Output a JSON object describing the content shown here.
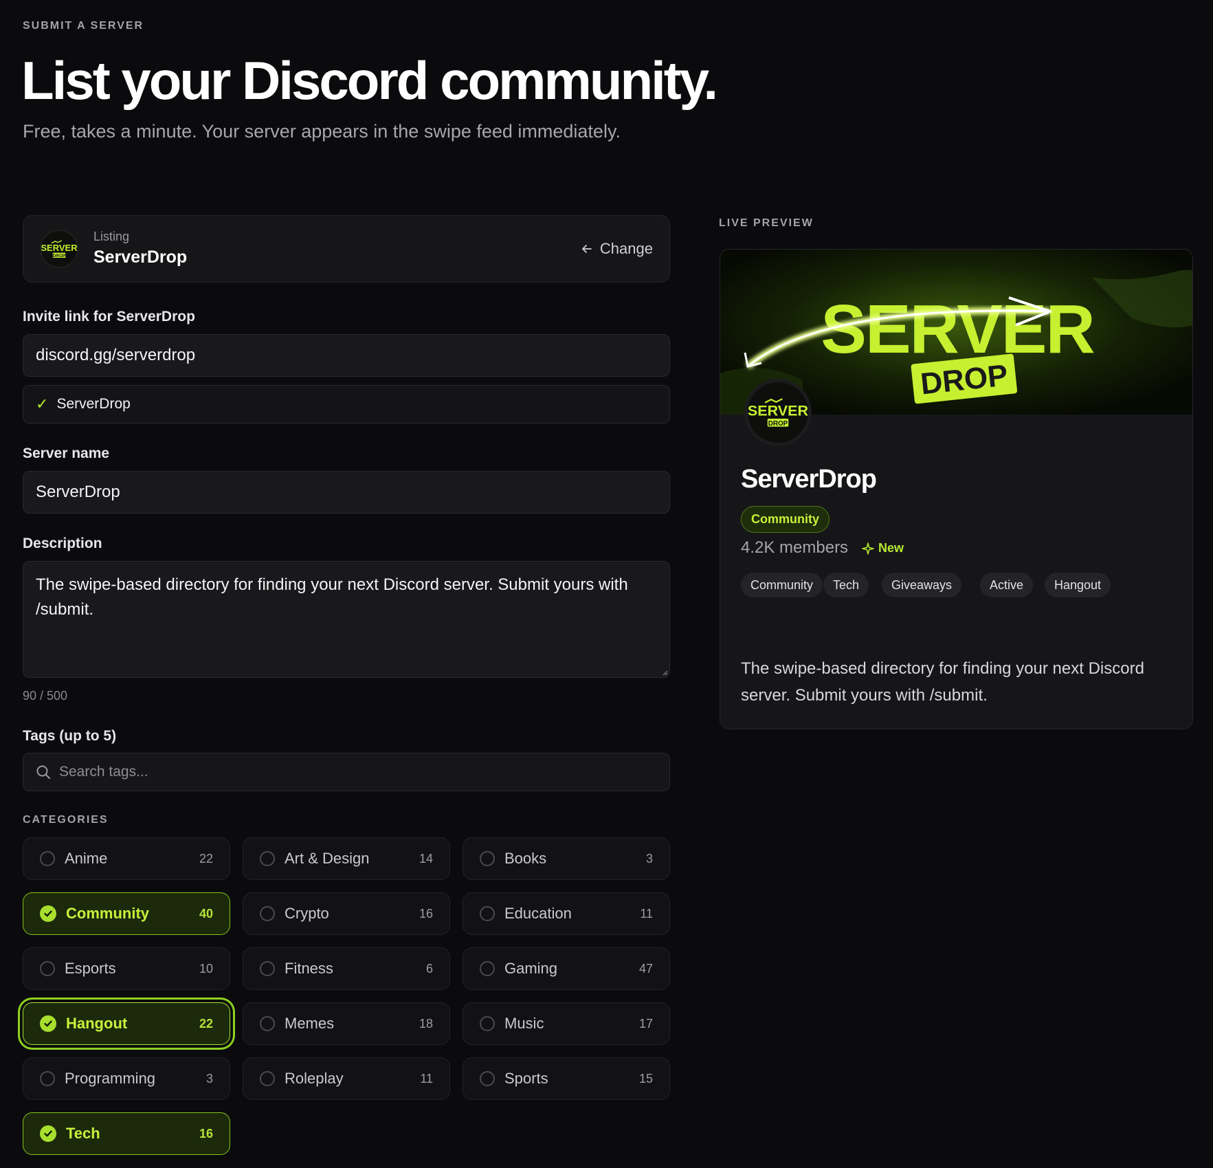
{
  "header": {
    "eyebrow": "SUBMIT A SERVER",
    "title": "List your Discord community.",
    "subtitle": "Free, takes a minute. Your server appears in the swipe feed immediately."
  },
  "listing": {
    "label": "Listing",
    "name": "ServerDrop",
    "change_label": "Change"
  },
  "form": {
    "invite_label": "Invite link for ServerDrop",
    "invite_value": "discord.gg/serverdrop",
    "verified_name": "ServerDrop",
    "server_name_label": "Server name",
    "server_name_value": "ServerDrop",
    "description_label": "Description",
    "description_value": "The swipe-based directory for finding your next Discord server. Submit yours with /submit.",
    "char_count": "90 / 500",
    "tags_label": "Tags (up to 5)",
    "tag_search_placeholder": "Search tags...",
    "categories_label": "CATEGORIES"
  },
  "categories": [
    {
      "name": "Anime",
      "count": "22",
      "selected": false
    },
    {
      "name": "Art & Design",
      "count": "14",
      "selected": false
    },
    {
      "name": "Books",
      "count": "3",
      "selected": false
    },
    {
      "name": "Community",
      "count": "40",
      "selected": true
    },
    {
      "name": "Crypto",
      "count": "16",
      "selected": false
    },
    {
      "name": "Education",
      "count": "11",
      "selected": false
    },
    {
      "name": "Esports",
      "count": "10",
      "selected": false
    },
    {
      "name": "Fitness",
      "count": "6",
      "selected": false
    },
    {
      "name": "Gaming",
      "count": "47",
      "selected": false
    },
    {
      "name": "Hangout",
      "count": "22",
      "selected": true,
      "focused": true
    },
    {
      "name": "Memes",
      "count": "18",
      "selected": false
    },
    {
      "name": "Music",
      "count": "17",
      "selected": false
    },
    {
      "name": "Programming",
      "count": "3",
      "selected": false
    },
    {
      "name": "Roleplay",
      "count": "11",
      "selected": false
    },
    {
      "name": "Sports",
      "count": "15",
      "selected": false
    },
    {
      "name": "Tech",
      "count": "16",
      "selected": true
    }
  ],
  "preview": {
    "label": "LIVE PREVIEW",
    "name": "ServerDrop",
    "category": "Community",
    "members": "4.2K members",
    "new_badge": "New",
    "tags": [
      "Community",
      "Tech",
      "Giveaways",
      "Active",
      "Hangout"
    ],
    "description": "The swipe-based directory for finding your next Discord server. Submit yours with /submit.",
    "banner_text_top": "SERVER",
    "banner_text_bottom": "DROP"
  },
  "colors": {
    "background": "#0b0b0d",
    "accent": "#b7ea33",
    "selected_bg": "#1c2a0b",
    "card": "#161618"
  }
}
